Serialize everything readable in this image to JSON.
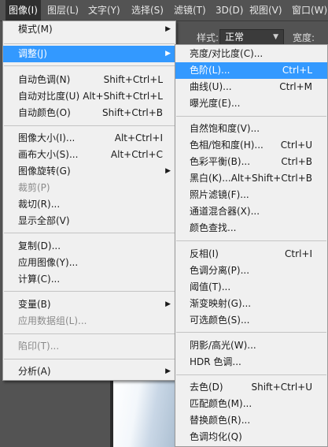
{
  "menubar": {
    "items": [
      {
        "label": "图像(I)"
      },
      {
        "label": "图层(L)"
      },
      {
        "label": "文字(Y)"
      },
      {
        "label": "选择(S)"
      },
      {
        "label": "滤镜(T)"
      },
      {
        "label": "3D(D)"
      },
      {
        "label": "视图(V)"
      },
      {
        "label": "窗口(W)"
      }
    ]
  },
  "options": {
    "style_label": "样式:",
    "style_value": "正常",
    "width_label": "宽度:"
  },
  "image_menu": {
    "items": [
      {
        "label": "模式(M)",
        "shortcut": "",
        "submenu": true
      },
      {
        "label": "调整(J)",
        "shortcut": "",
        "submenu": true
      },
      {
        "label": "自动色调(N)",
        "shortcut": "Shift+Ctrl+L"
      },
      {
        "label": "自动对比度(U)",
        "shortcut": "Alt+Shift+Ctrl+L"
      },
      {
        "label": "自动颜色(O)",
        "shortcut": "Shift+Ctrl+B"
      },
      {
        "label": "图像大小(I)...",
        "shortcut": "Alt+Ctrl+I"
      },
      {
        "label": "画布大小(S)...",
        "shortcut": "Alt+Ctrl+C"
      },
      {
        "label": "图像旋转(G)",
        "shortcut": "",
        "submenu": true
      },
      {
        "label": "裁剪(P)",
        "shortcut": "",
        "disabled": true
      },
      {
        "label": "裁切(R)...",
        "shortcut": ""
      },
      {
        "label": "显示全部(V)",
        "shortcut": ""
      },
      {
        "label": "复制(D)...",
        "shortcut": ""
      },
      {
        "label": "应用图像(Y)...",
        "shortcut": ""
      },
      {
        "label": "计算(C)...",
        "shortcut": ""
      },
      {
        "label": "变量(B)",
        "shortcut": "",
        "submenu": true
      },
      {
        "label": "应用数据组(L)...",
        "shortcut": "",
        "disabled": true
      },
      {
        "label": "陷印(T)...",
        "shortcut": "",
        "disabled": true
      },
      {
        "label": "分析(A)",
        "shortcut": "",
        "submenu": true
      }
    ]
  },
  "adjust_menu": {
    "items": [
      {
        "label": "亮度/对比度(C)...",
        "shortcut": ""
      },
      {
        "label": "色阶(L)...",
        "shortcut": "Ctrl+L"
      },
      {
        "label": "曲线(U)...",
        "shortcut": "Ctrl+M"
      },
      {
        "label": "曝光度(E)...",
        "shortcut": ""
      },
      {
        "label": "自然饱和度(V)...",
        "shortcut": ""
      },
      {
        "label": "色相/饱和度(H)...",
        "shortcut": "Ctrl+U"
      },
      {
        "label": "色彩平衡(B)...",
        "shortcut": "Ctrl+B"
      },
      {
        "label": "黑白(K)...",
        "shortcut": "Alt+Shift+Ctrl+B"
      },
      {
        "label": "照片滤镜(F)...",
        "shortcut": ""
      },
      {
        "label": "通道混合器(X)...",
        "shortcut": ""
      },
      {
        "label": "颜色查找...",
        "shortcut": ""
      },
      {
        "label": "反相(I)",
        "shortcut": "Ctrl+I"
      },
      {
        "label": "色调分离(P)...",
        "shortcut": ""
      },
      {
        "label": "阈值(T)...",
        "shortcut": ""
      },
      {
        "label": "渐变映射(G)...",
        "shortcut": ""
      },
      {
        "label": "可选颜色(S)...",
        "shortcut": ""
      },
      {
        "label": "阴影/高光(W)...",
        "shortcut": ""
      },
      {
        "label": "HDR 色调...",
        "shortcut": ""
      },
      {
        "label": "去色(D)",
        "shortcut": "Shift+Ctrl+U"
      },
      {
        "label": "匹配颜色(M)...",
        "shortcut": ""
      },
      {
        "label": "替换颜色(R)...",
        "shortcut": ""
      },
      {
        "label": "色调均化(Q)",
        "shortcut": ""
      }
    ]
  },
  "colors": {
    "highlight": "#3399ff",
    "menu_background": "#f0f0f0",
    "app_background": "#535353"
  }
}
